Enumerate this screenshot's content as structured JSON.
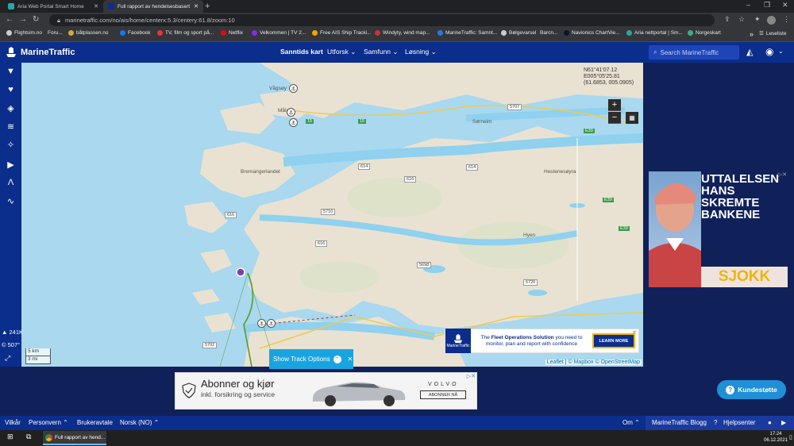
{
  "browser": {
    "tabs": [
      {
        "label": "Ariа Web Portal Smart Home",
        "active": false
      },
      {
        "label": "Full rapport av hendelsesbasert",
        "active": true
      }
    ],
    "new_tab": "+",
    "window_controls": [
      "–",
      "❐",
      "✕"
    ],
    "url": "marinetraffic.com/no/ais/home/centerx:5.3/centery:61.8/zoom:10",
    "reading_list": "Leseliste",
    "bookmarks": [
      "Flightsim.no",
      "Foru...",
      "båtplassen.no",
      "Facebook",
      "TV, film og sport på...",
      "Netflix",
      "Velkommen | TV 2...",
      "Free AIS Ship Tracki...",
      "Windyty, wind map...",
      "MarineTraffic: Samnt...",
      "Bølgevarsel",
      "Barcn...",
      "Navionics ChartVie...",
      "Aria nettportal | Sm...",
      "Norgeskart"
    ]
  },
  "header": {
    "brand": "MarineTraffic",
    "menu": [
      {
        "label": "Sanntids kart",
        "active": true
      },
      {
        "label": "Utforsk ⌄",
        "active": false
      },
      {
        "label": "Samfunn ⌄",
        "active": false
      },
      {
        "label": "Løsning ⌄",
        "active": false
      }
    ],
    "search_placeholder": "Search MarineTraffic"
  },
  "map": {
    "coords": [
      "N61°41'07.12",
      "E005°05'25.81",
      "(61.6853, 005.0905)"
    ],
    "zoom_in": "+",
    "zoom_out": "−",
    "scale_km": "5 km",
    "scale_mi": "3 mi",
    "attribution": [
      "Leaflet",
      "|",
      "© Mapbox",
      "© OpenStreetMap"
    ],
    "place_labels": [
      "Vågsøy",
      "Måløy",
      "Bremangerlandet",
      "Sørneim",
      "Hestenesøyra",
      "Hyen"
    ],
    "road_labels": [
      "E39",
      "E39",
      "E39",
      "614",
      "614",
      "616",
      "616",
      "616",
      "5707",
      "5710",
      "5720",
      "5698",
      "5702",
      "15",
      "15"
    ]
  },
  "map_ad": {
    "text_pre": "The",
    "text_bold": "Fleet Operations Solution",
    "text_post": "you need to monitor, plan and report with confidence",
    "button": "LEARN MORE",
    "logo": "MarineTraffic"
  },
  "show_track": {
    "label": "Show Track Options",
    "close": "✕"
  },
  "stats": {
    "vessels": "241K",
    "temp": "507°"
  },
  "side_ad": {
    "headline": "UTTALELSEN HANS SKREMTE BANKENE",
    "tag": "SJOKK"
  },
  "bottom_ad": {
    "headline": "Abonner og kjør",
    "sub": "inkl. forsikring og service",
    "brand": "VOLVO",
    "cta": "ABONNER NÅ"
  },
  "support": {
    "label": "Kundestøtte"
  },
  "footer": {
    "left": [
      "Vilkår",
      "Personvern ⌃",
      "Brukeravtale",
      "Norsk (NO) ⌃"
    ],
    "right": [
      "Om ⌃",
      "MarineTraffic Blogg",
      "Hjelpsenter"
    ]
  },
  "taskbar": {
    "app": "Full rapport av hend...",
    "time": "17:24",
    "date": "06.12.2021"
  },
  "colors": {
    "navy": "#0b2d8c",
    "sea": "#a8d9f0",
    "land": "#e8e0cf",
    "accent": "#19a4e0"
  }
}
